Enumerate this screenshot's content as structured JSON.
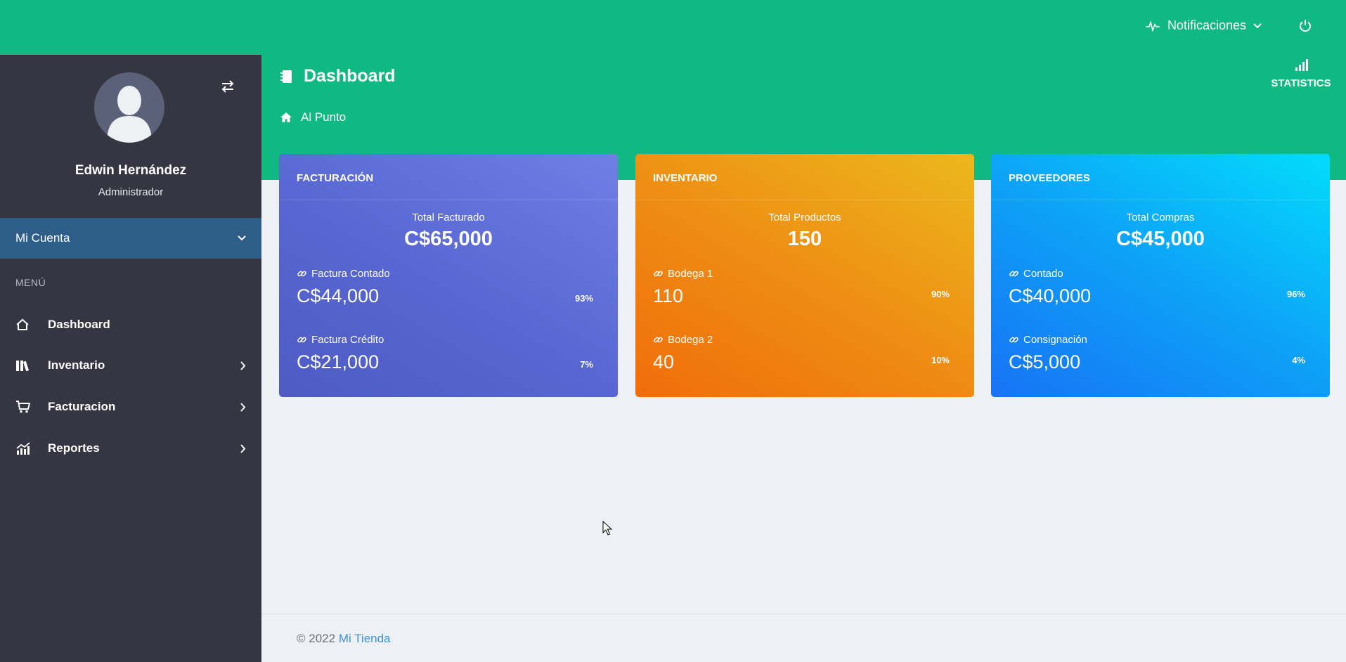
{
  "topbar": {
    "notifications_label": "Notificaciones"
  },
  "sidebar": {
    "user_name": "Edwin Hernández",
    "user_role": "Administrador",
    "account_label": "Mi Cuenta",
    "menu_label": "MENÚ",
    "items": [
      {
        "label": "Dashboard",
        "icon": "home-icon"
      },
      {
        "label": "Inventario",
        "icon": "books-icon"
      },
      {
        "label": "Facturacion",
        "icon": "cart-icon"
      },
      {
        "label": "Reportes",
        "icon": "chart-icon"
      }
    ]
  },
  "header": {
    "title": "Dashboard",
    "breadcrumb": "Al Punto",
    "statistics_label": "STATISTICS"
  },
  "cards": [
    {
      "title": "FACTURACIÓN",
      "subtitle": "Total Facturado",
      "total": "C$65,000",
      "rows": [
        {
          "label": "Factura Contado",
          "value": "C$44,000",
          "pct": "93%"
        },
        {
          "label": "Factura Crédito",
          "value": "C$21,000",
          "pct": "7%"
        }
      ]
    },
    {
      "title": "INVENTARIO",
      "subtitle": "Total Productos",
      "total": "150",
      "rows": [
        {
          "label": "Bodega 1",
          "value": "110",
          "pct": "90%"
        },
        {
          "label": "Bodega 2",
          "value": "40",
          "pct": "10%"
        }
      ]
    },
    {
      "title": "PROVEEDORES",
      "subtitle": "Total Compras",
      "total": "C$45,000",
      "rows": [
        {
          "label": "Contado",
          "value": "C$40,000",
          "pct": "96%"
        },
        {
          "label": "Consignación",
          "value": "C$5,000",
          "pct": "4%"
        }
      ]
    }
  ],
  "footer": {
    "copyright": "© 2022",
    "brand": "Mi Tienda"
  },
  "colors": {
    "primary_green": "#0fb981",
    "sidebar": "#353642",
    "account_bar": "#2f5d89",
    "link": "#3d93d6"
  }
}
